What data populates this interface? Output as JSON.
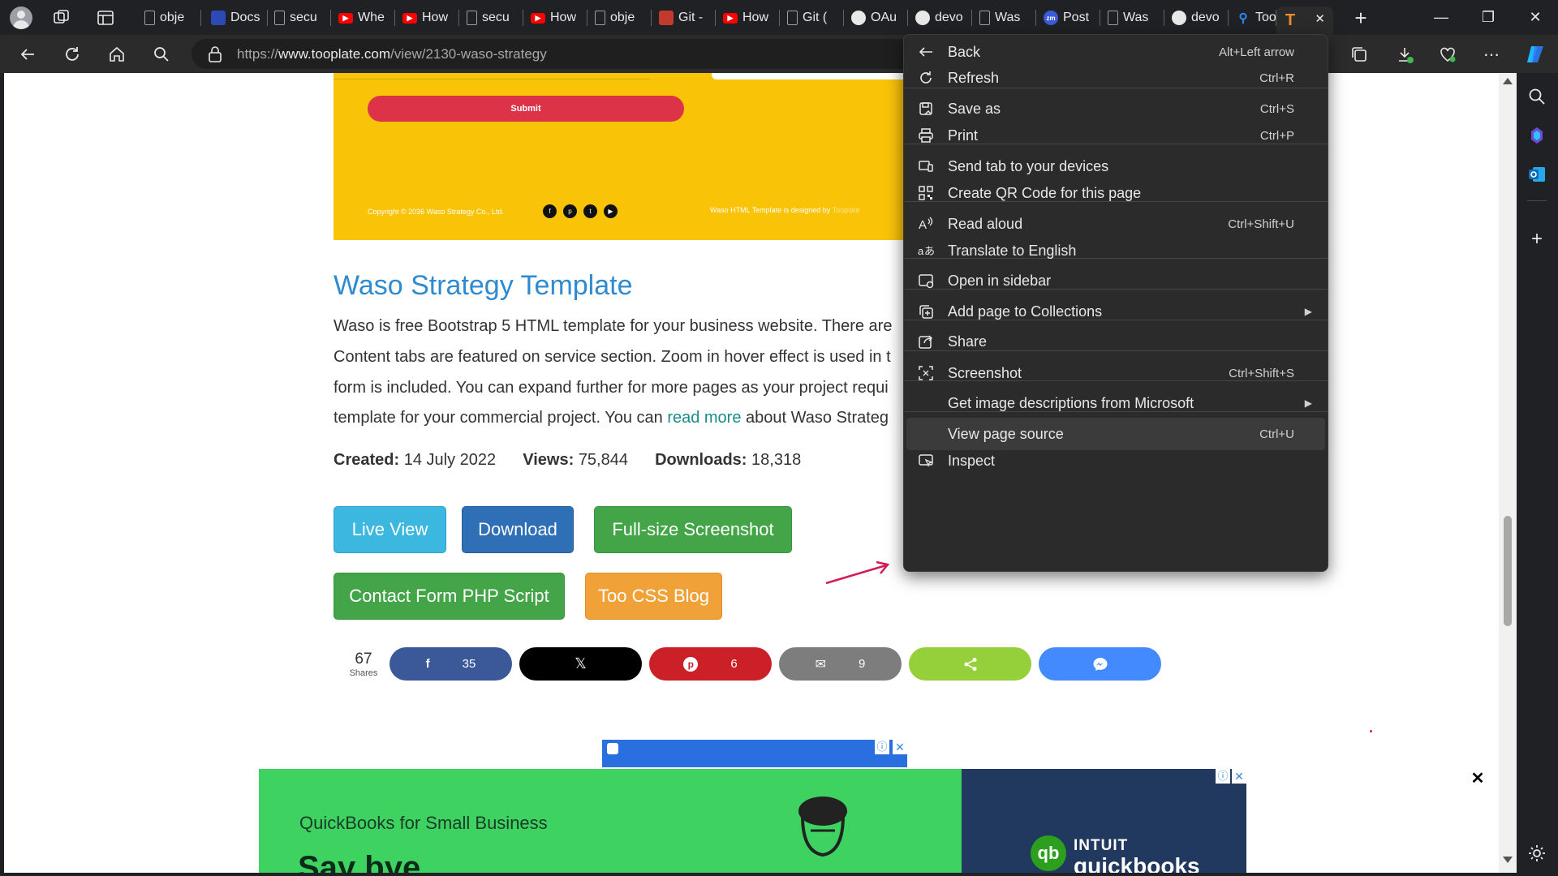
{
  "tabs": [
    {
      "title": "obje",
      "favicon": "page-icon"
    },
    {
      "title": "Docs",
      "favicon": "docs-icon"
    },
    {
      "title": "secu",
      "favicon": "page-icon"
    },
    {
      "title": "Whe",
      "favicon": "youtube-icon"
    },
    {
      "title": "How",
      "favicon": "youtube-icon"
    },
    {
      "title": "secu",
      "favicon": "file-icon"
    },
    {
      "title": "How",
      "favicon": "youtube-icon"
    },
    {
      "title": "obje",
      "favicon": "page-icon"
    },
    {
      "title": "Git -",
      "favicon": "git-icon"
    },
    {
      "title": "How",
      "favicon": "youtube-icon"
    },
    {
      "title": "Git (",
      "favicon": "file-icon"
    },
    {
      "title": "OAu",
      "favicon": "github-icon"
    },
    {
      "title": "devo",
      "favicon": "github-icon"
    },
    {
      "title": "Was",
      "favicon": "file-icon"
    },
    {
      "title": "Post",
      "favicon": "zm-icon"
    },
    {
      "title": "Was",
      "favicon": "file-icon"
    },
    {
      "title": "devo",
      "favicon": "github-icon"
    },
    {
      "title": "Toop",
      "favicon": "search-icon"
    },
    {
      "title": "",
      "favicon": "tooplate-icon",
      "active": true
    }
  ],
  "url": {
    "prefix": "https://",
    "host": "www.tooplate.com",
    "path": "/view/2130-waso-strategy"
  },
  "page": {
    "submit_label": "Submit",
    "copyright": "Copyright © 2036 Waso Strategy Co., Ltd.",
    "designed_by_text": "Waso HTML Template is designed by",
    "designed_by_link": "Tooplate",
    "title": "Waso Strategy Template",
    "desc_line1": "Waso is free Bootstrap 5 HTML template for your business website. There are",
    "desc_line2": "Content tabs are featured on service section. Zoom in hover effect is used in t",
    "desc_line3": "form is included. You can expand further for more pages as your project requi",
    "desc_line4_pre": "template for your commercial project. You can ",
    "desc_line4_link": "read more",
    "desc_line4_post": " about Waso Strateg",
    "created_label": "Created:",
    "created_value": "14 July 2022",
    "views_label": "Views:",
    "views_value": "75,844",
    "downloads_label": "Downloads:",
    "downloads_value": "18,318",
    "buttons": {
      "live_view": "Live View",
      "download": "Download",
      "full_screenshot": "Full-size Screenshot",
      "contact_form": "Contact Form PHP Script",
      "blog": "Too CSS Blog"
    },
    "shares_total": "67",
    "shares_label": "Shares",
    "share_counts": {
      "facebook": "35",
      "x": "",
      "pinterest": "6",
      "email": "9",
      "sharethis": "",
      "messenger": ""
    },
    "ad_title": "QuickBooks for Small Business",
    "ad_headline": "Say bye",
    "ad_brand1": "INTUIT",
    "ad_brand2": "quickbooks"
  },
  "menu": {
    "items": [
      {
        "label": "Back",
        "shortcut": "Alt+Left arrow",
        "icon": "arrow-left-icon"
      },
      {
        "label": "Refresh",
        "shortcut": "Ctrl+R",
        "icon": "refresh-icon"
      },
      {
        "label": "Save as",
        "shortcut": "Ctrl+S",
        "icon": "save-icon"
      },
      {
        "label": "Print",
        "shortcut": "Ctrl+P",
        "icon": "print-icon"
      },
      {
        "label": "Send tab to your devices",
        "shortcut": "",
        "icon": "devices-icon"
      },
      {
        "label": "Create QR Code for this page",
        "shortcut": "",
        "icon": "qr-code-icon"
      },
      {
        "label": "Read aloud",
        "shortcut": "Ctrl+Shift+U",
        "icon": "read-aloud-icon"
      },
      {
        "label": "Translate to English",
        "shortcut": "",
        "icon": "translate-icon"
      },
      {
        "label": "Open in sidebar",
        "shortcut": "",
        "icon": "sidebar-icon"
      },
      {
        "label": "Add page to Collections",
        "shortcut": "",
        "icon": "collections-icon"
      },
      {
        "label": "Share",
        "shortcut": "",
        "icon": "share-icon"
      },
      {
        "label": "Screenshot",
        "shortcut": "Ctrl+Shift+S",
        "icon": "screenshot-icon"
      },
      {
        "label": "Get image descriptions from Microsoft",
        "shortcut": "",
        "icon": ""
      },
      {
        "label": "View page source",
        "shortcut": "Ctrl+U",
        "icon": ""
      },
      {
        "label": "Inspect",
        "shortcut": "",
        "icon": "inspect-icon"
      }
    ]
  },
  "colors": {
    "accent_title": "#2e8bcf",
    "yellow": "#f9c307",
    "submit_red": "#dd3348"
  }
}
